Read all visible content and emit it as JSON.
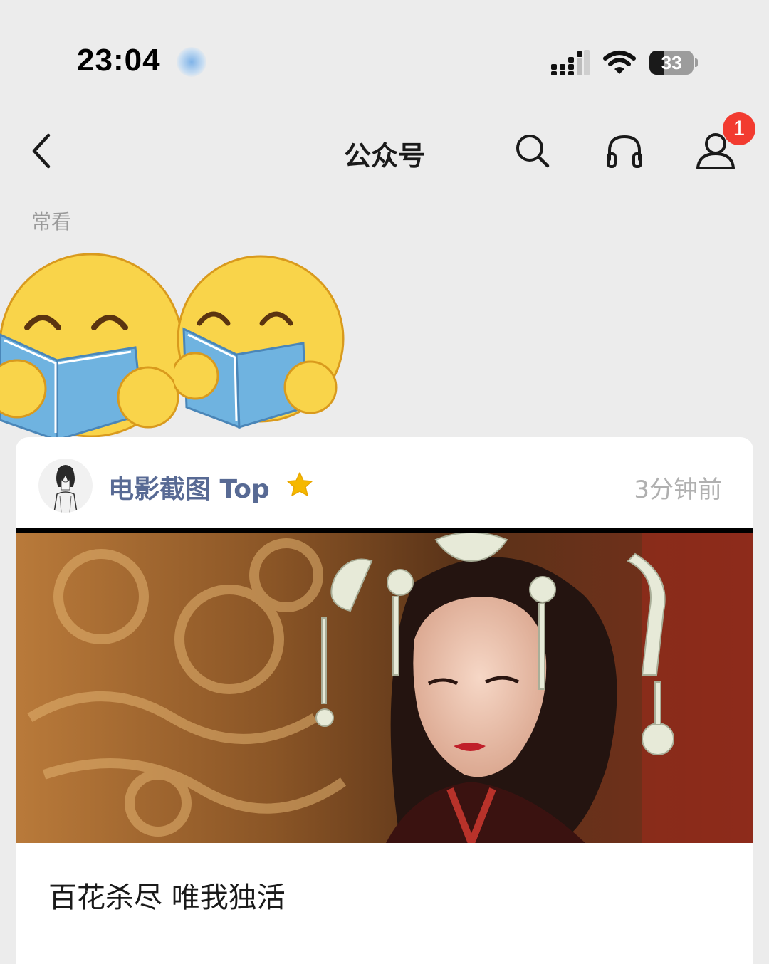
{
  "status_bar": {
    "time": "23:04",
    "battery": "33"
  },
  "nav": {
    "title": "公众号",
    "notification_count": "1"
  },
  "section": {
    "label": "常看"
  },
  "post": {
    "account_name": "电影截图 Top",
    "time": "3分钟前",
    "title": "百花杀尽 唯我独活"
  }
}
